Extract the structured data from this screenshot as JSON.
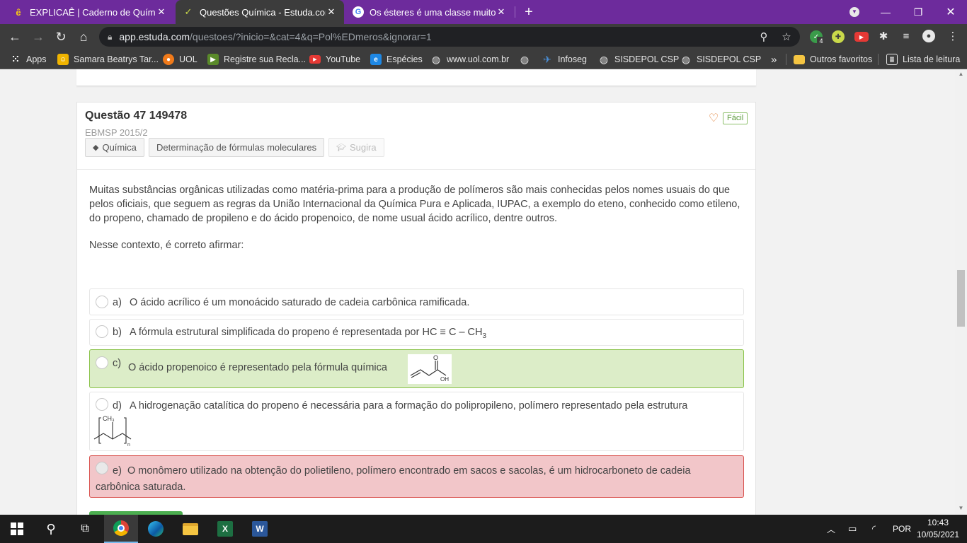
{
  "browser": {
    "tabs": [
      {
        "title": "EXPLICAÊ | Caderno de Química",
        "icon": "explicae-icon",
        "active": false
      },
      {
        "title": "Questões Química - Estuda.com E",
        "icon": "estuda-icon",
        "active": true
      },
      {
        "title": "Os ésteres é uma classe muito im",
        "icon": "google-icon",
        "active": false
      }
    ],
    "url_host": "app.estuda.com",
    "url_path": "/questoes/?inicio=&cat=4&q=Pol%EDmeros&ignorar=1",
    "extension_badge": "4"
  },
  "bookmarks": [
    {
      "label": "Apps",
      "icon": "apps-grid-icon"
    },
    {
      "label": "Samara Beatrys Tar...",
      "icon": "contact-icon"
    },
    {
      "label": "UOL",
      "icon": "uol-icon"
    },
    {
      "label": "Registre sua Recla...",
      "icon": "reclame-icon"
    },
    {
      "label": "YouTube",
      "icon": "youtube-icon"
    },
    {
      "label": "Espécies",
      "icon": "especies-icon"
    },
    {
      "label": "www.uol.com.br",
      "icon": "globe-icon"
    },
    {
      "label": "",
      "icon": "globe-icon"
    },
    {
      "label": "Infoseg",
      "icon": "infoseg-icon"
    },
    {
      "label": "SISDEPOL CSP",
      "icon": "globe-icon"
    },
    {
      "label": "SISDEPOL CSP",
      "icon": "globe-icon"
    }
  ],
  "bookmarks_overflow": "»",
  "other_favorites": "Outros favoritos",
  "reading_list": "Lista de leitura",
  "question": {
    "title": "Questão 47 149478",
    "source": "EBMSP 2015/2",
    "difficulty": "Fácil",
    "tags": [
      "Química",
      "Determinação de fórmulas moleculares",
      "Sugira"
    ],
    "statement": "Muitas substâncias orgânicas utilizadas como matéria-prima para a produção de polímeros são mais conhecidas pelos nomes usuais do que pelos oficiais, que seguem as regras da União Internacional da Química Pura e Aplicada, IUPAC, a exemplo do eteno, conhecido como etileno, do propeno, chamado de propileno e do ácido propenoico, de nome usual ácido acrílico, dentre outros.",
    "prompt": "Nesse contexto, é correto afirmar:",
    "options": [
      {
        "letter": "a)",
        "text": "O ácido acrílico é um monoácido saturado de cadeia carbônica ramificada.",
        "status": "neutral"
      },
      {
        "letter": "b)",
        "text": "A fórmula estrutural simplificada do propeno é representada por HC ≡ C – CH",
        "subscript": "3",
        "status": "neutral"
      },
      {
        "letter": "c)",
        "text": "O ácido propenoico é representado pela fórmula química",
        "status": "correct"
      },
      {
        "letter": "d)",
        "text": "A hidrogenação catalítica do propeno é necessária para a formação do polipropileno, polímero representado pela estrutura",
        "status": "neutral"
      },
      {
        "letter": "e)",
        "text": "O monômero utilizado na obtenção do polietileno, polímero encontrado em sacos e sacolas, é um hidrocarboneto de cadeia carbônica saturada.",
        "status": "wrong"
      }
    ],
    "formula_labels": {
      "oxygen": "O",
      "hydroxyl": "OH",
      "methyl": "CH₃",
      "repeat": "n"
    }
  },
  "taskbar": {
    "language": "POR",
    "time": "10:43",
    "date": "10/05/2021"
  },
  "colors": {
    "tabstrip": "#6d2b9c",
    "chrome_dark": "#3c3c3c",
    "correct_bg": "#dcedc8",
    "correct_border": "#8bc34a",
    "wrong_bg": "#f2c6c9",
    "wrong_border": "#d9534f"
  }
}
